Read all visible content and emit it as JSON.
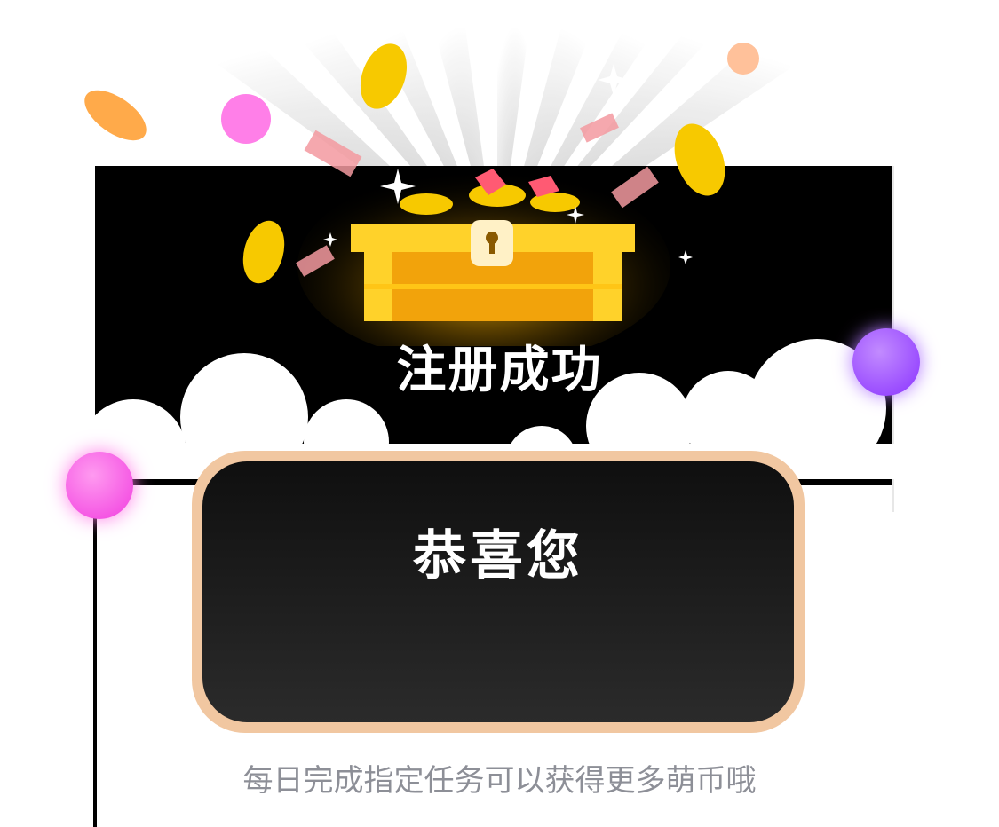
{
  "dialog": {
    "title": "注册成功",
    "congrats": "恭喜您",
    "hint": "每日完成指定任务可以获得更多萌币哦"
  },
  "icons": [
    "treasure-chest-icon",
    "gold-coin-icon",
    "sparkle-icon",
    "banknote-icon",
    "gem-icon",
    "bubble-icon"
  ],
  "colors": {
    "panel_border": "#f1c7a1",
    "panel_bg": "#1a1a1a",
    "hint_text": "#8d8f97",
    "chest_gold": "#f5b800",
    "bubble_pink": "#ff55e5",
    "bubble_purple": "#9a4dff",
    "bubble_peach": "#ffc19a"
  }
}
